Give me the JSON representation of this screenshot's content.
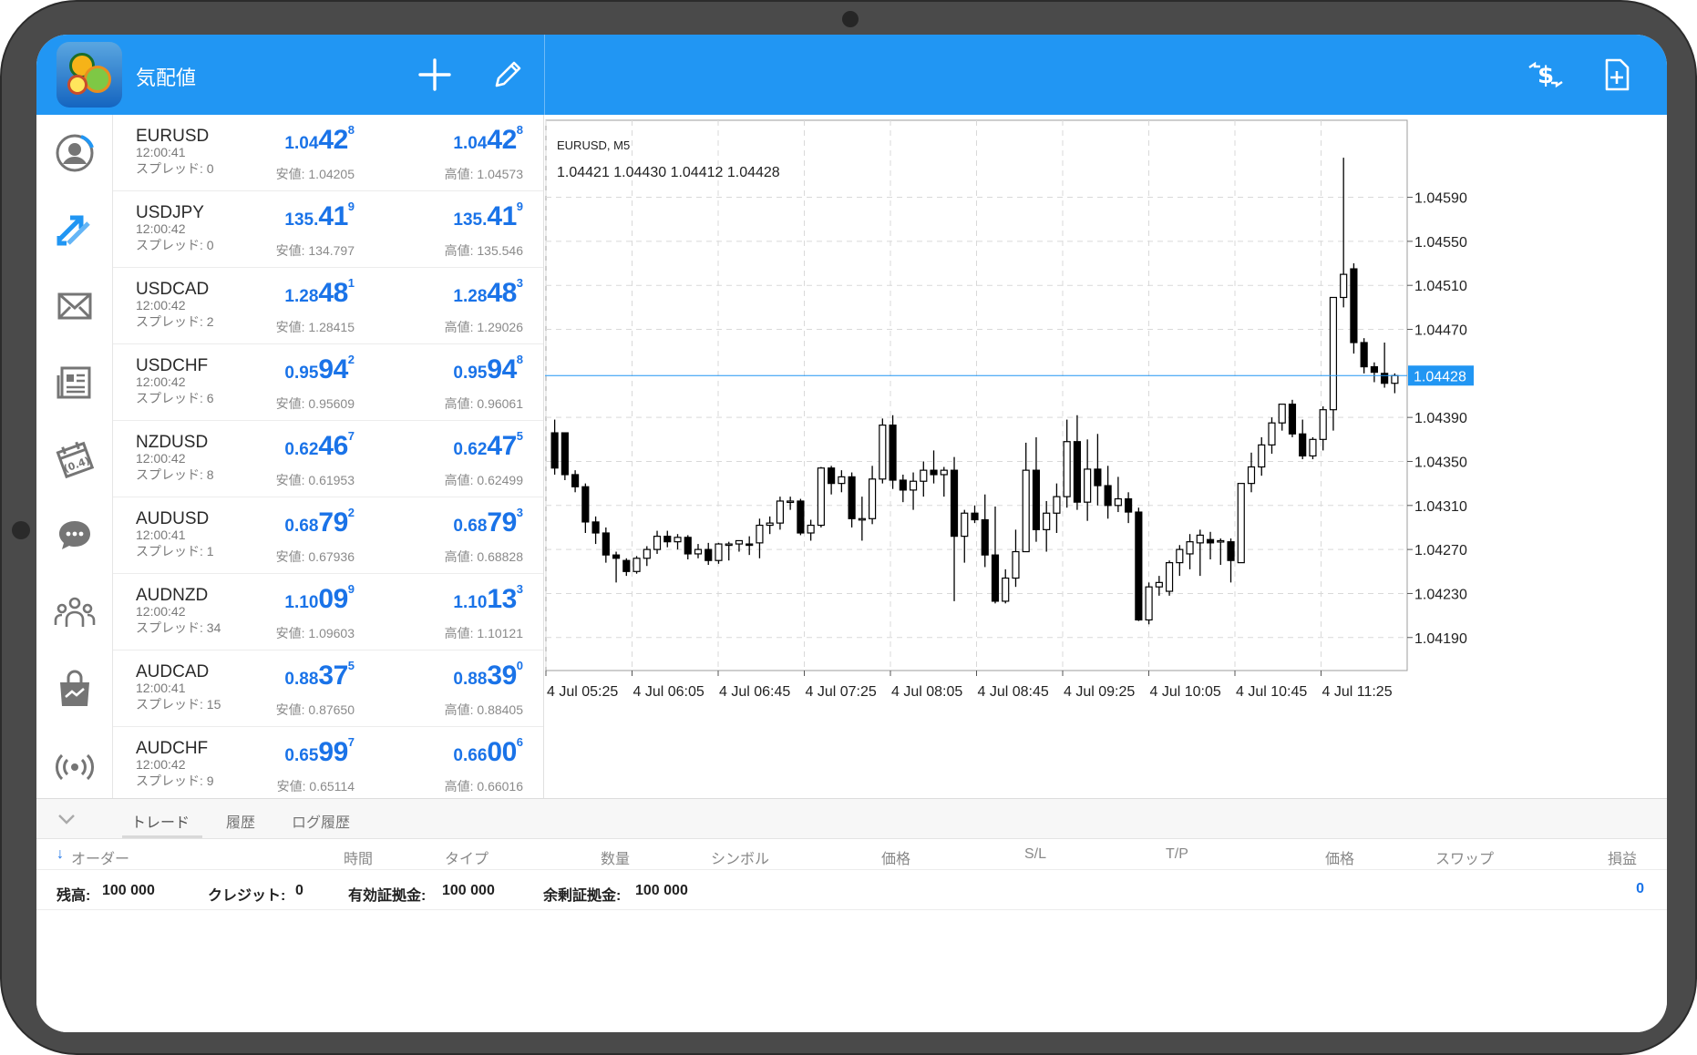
{
  "app": {
    "title": "気配値"
  },
  "nav": [
    {
      "name": "nav-account-icon"
    },
    {
      "name": "nav-trade-icon"
    },
    {
      "name": "nav-mail-icon"
    },
    {
      "name": "nav-news-icon"
    },
    {
      "name": "nav-calendar-icon"
    },
    {
      "name": "nav-chat-icon"
    },
    {
      "name": "nav-community-icon"
    },
    {
      "name": "nav-market-icon"
    },
    {
      "name": "nav-signals-icon"
    }
  ],
  "quotes": [
    {
      "symbol": "EURUSD",
      "time": "12:00:41",
      "spread": "スプレッド: 0",
      "bid": {
        "small": "1.04",
        "big": "42",
        "pip": "8"
      },
      "ask": {
        "small": "1.04",
        "big": "42",
        "pip": "8"
      },
      "low": "安値: 1.04205",
      "high": "高値: 1.04573"
    },
    {
      "symbol": "USDJPY",
      "time": "12:00:42",
      "spread": "スプレッド: 0",
      "bid": {
        "small": "135.",
        "big": "41",
        "pip": "9"
      },
      "ask": {
        "small": "135.",
        "big": "41",
        "pip": "9"
      },
      "low": "安値: 134.797",
      "high": "高値: 135.546"
    },
    {
      "symbol": "USDCAD",
      "time": "12:00:42",
      "spread": "スプレッド: 2",
      "bid": {
        "small": "1.28",
        "big": "48",
        "pip": "1"
      },
      "ask": {
        "small": "1.28",
        "big": "48",
        "pip": "3"
      },
      "low": "安値: 1.28415",
      "high": "高値: 1.29026"
    },
    {
      "symbol": "USDCHF",
      "time": "12:00:42",
      "spread": "スプレッド: 6",
      "bid": {
        "small": "0.95",
        "big": "94",
        "pip": "2"
      },
      "ask": {
        "small": "0.95",
        "big": "94",
        "pip": "8"
      },
      "low": "安値: 0.95609",
      "high": "高値: 0.96061"
    },
    {
      "symbol": "NZDUSD",
      "time": "12:00:42",
      "spread": "スプレッド: 8",
      "bid": {
        "small": "0.62",
        "big": "46",
        "pip": "7"
      },
      "ask": {
        "small": "0.62",
        "big": "47",
        "pip": "5"
      },
      "low": "安値: 0.61953",
      "high": "高値: 0.62499"
    },
    {
      "symbol": "AUDUSD",
      "time": "12:00:41",
      "spread": "スプレッド: 1",
      "bid": {
        "small": "0.68",
        "big": "79",
        "pip": "2"
      },
      "ask": {
        "small": "0.68",
        "big": "79",
        "pip": "3"
      },
      "low": "安値: 0.67936",
      "high": "高値: 0.68828"
    },
    {
      "symbol": "AUDNZD",
      "time": "12:00:42",
      "spread": "スプレッド: 34",
      "bid": {
        "small": "1.10",
        "big": "09",
        "pip": "9"
      },
      "ask": {
        "small": "1.10",
        "big": "13",
        "pip": "3"
      },
      "low": "安値: 1.09603",
      "high": "高値: 1.10121"
    },
    {
      "symbol": "AUDCAD",
      "time": "12:00:41",
      "spread": "スプレッド: 15",
      "bid": {
        "small": "0.88",
        "big": "37",
        "pip": "5"
      },
      "ask": {
        "small": "0.88",
        "big": "39",
        "pip": "0"
      },
      "low": "安値: 0.87650",
      "high": "高値: 0.88405"
    },
    {
      "symbol": "AUDCHF",
      "time": "12:00:42",
      "spread": "スプレッド: 9",
      "bid": {
        "small": "0.65",
        "big": "99",
        "pip": "7"
      },
      "ask": {
        "small": "0.66",
        "big": "00",
        "pip": "6"
      },
      "low": "安値: 0.65114",
      "high": "高値: 0.66016"
    }
  ],
  "chart_data": {
    "type": "candlestick",
    "title": "EURUSD, M5",
    "ohlc_label": "1.04421 1.04430 1.04412 1.04428",
    "current_price": 1.04428,
    "current_price_label": "1.04428",
    "ylim": [
      1.0416,
      1.0466
    ],
    "y_ticks": [
      "1.04590",
      "1.04550",
      "1.04510",
      "1.04470",
      "1.04390",
      "1.04350",
      "1.04310",
      "1.04270",
      "1.04230",
      "1.04190"
    ],
    "x_ticks": [
      "4 Jul 05:25",
      "4 Jul 06:05",
      "4 Jul 06:45",
      "4 Jul 07:25",
      "4 Jul 08:05",
      "4 Jul 08:45",
      "4 Jul 09:25",
      "4 Jul 10:05",
      "4 Jul 10:45",
      "4 Jul 11:25"
    ],
    "candles": [
      [
        1.04376,
        1.04388,
        1.04338,
        1.04344
      ],
      [
        1.04376,
        1.04376,
        1.04333,
        1.04338
      ],
      [
        1.04338,
        1.04342,
        1.04322,
        1.04327
      ],
      [
        1.04327,
        1.0433,
        1.04285,
        1.04295
      ],
      [
        1.04295,
        1.043,
        1.04275,
        1.04285
      ],
      [
        1.04285,
        1.0429,
        1.04258,
        1.04265
      ],
      [
        1.04265,
        1.04268,
        1.0424,
        1.04262
      ],
      [
        1.0426,
        1.04262,
        1.04246,
        1.0425
      ],
      [
        1.0425,
        1.04264,
        1.04248,
        1.04262
      ],
      [
        1.04262,
        1.04273,
        1.04255,
        1.0427
      ],
      [
        1.0427,
        1.04287,
        1.04266,
        1.04282
      ],
      [
        1.04282,
        1.04287,
        1.04272,
        1.04277
      ],
      [
        1.04277,
        1.04284,
        1.0427,
        1.04281
      ],
      [
        1.04281,
        1.04283,
        1.04261,
        1.04266
      ],
      [
        1.04266,
        1.04275,
        1.04262,
        1.0427
      ],
      [
        1.0427,
        1.04276,
        1.04256,
        1.0426
      ],
      [
        1.0426,
        1.04276,
        1.04257,
        1.04275
      ],
      [
        1.04275,
        1.04277,
        1.0426,
        1.04275
      ],
      [
        1.04275,
        1.04278,
        1.04268,
        1.04278
      ],
      [
        1.04275,
        1.04282,
        1.04265,
        1.04274
      ],
      [
        1.04276,
        1.04298,
        1.04262,
        1.04292
      ],
      [
        1.04292,
        1.043,
        1.04284,
        1.04294
      ],
      [
        1.04294,
        1.04318,
        1.04288,
        1.04314
      ],
      [
        1.04314,
        1.04318,
        1.04306,
        1.04314
      ],
      [
        1.04314,
        1.04316,
        1.04283,
        1.04285
      ],
      [
        1.04285,
        1.04297,
        1.04278,
        1.04292
      ],
      [
        1.04292,
        1.04345,
        1.0429,
        1.04344
      ],
      [
        1.04344,
        1.04346,
        1.0432,
        1.0433
      ],
      [
        1.0433,
        1.04342,
        1.04322,
        1.04336
      ],
      [
        1.04336,
        1.0434,
        1.0429,
        1.04298
      ],
      [
        1.04298,
        1.04318,
        1.04278,
        1.04298
      ],
      [
        1.04298,
        1.04346,
        1.04293,
        1.04334
      ],
      [
        1.04334,
        1.04389,
        1.0433,
        1.04383
      ],
      [
        1.04383,
        1.04392,
        1.04325,
        1.04333
      ],
      [
        1.04333,
        1.04338,
        1.04313,
        1.04324
      ],
      [
        1.04324,
        1.0434,
        1.04306,
        1.04332
      ],
      [
        1.04332,
        1.0435,
        1.04318,
        1.04342
      ],
      [
        1.04342,
        1.0436,
        1.0433,
        1.04338
      ],
      [
        1.04338,
        1.04345,
        1.04318,
        1.04342
      ],
      [
        1.04342,
        1.04354,
        1.04223,
        1.04282
      ],
      [
        1.04282,
        1.04306,
        1.04258,
        1.04303
      ],
      [
        1.04303,
        1.0431,
        1.04294,
        1.04297
      ],
      [
        1.04297,
        1.0432,
        1.04254,
        1.04265
      ],
      [
        1.04265,
        1.04309,
        1.04221,
        1.04223
      ],
      [
        1.04223,
        1.04252,
        1.04221,
        1.04244
      ],
      [
        1.04244,
        1.04288,
        1.04236,
        1.04268
      ],
      [
        1.04268,
        1.04367,
        1.04268,
        1.04342
      ],
      [
        1.04342,
        1.04372,
        1.04277,
        1.04288
      ],
      [
        1.04288,
        1.04314,
        1.04268,
        1.04303
      ],
      [
        1.04303,
        1.0433,
        1.04285,
        1.04318
      ],
      [
        1.04318,
        1.04388,
        1.04308,
        1.04368
      ],
      [
        1.04368,
        1.04392,
        1.04306,
        1.04313
      ],
      [
        1.04313,
        1.0437,
        1.04296,
        1.04343
      ],
      [
        1.04343,
        1.04375,
        1.0431,
        1.04328
      ],
      [
        1.04328,
        1.04346,
        1.04298,
        1.0431
      ],
      [
        1.0431,
        1.04336,
        1.04304,
        1.04316
      ],
      [
        1.04316,
        1.04322,
        1.04294,
        1.04304
      ],
      [
        1.04304,
        1.04308,
        1.04205,
        1.04206
      ],
      [
        1.04206,
        1.0424,
        1.04202,
        1.04236
      ],
      [
        1.04236,
        1.04246,
        1.04228,
        1.0424
      ],
      [
        1.04232,
        1.0426,
        1.04228,
        1.04258
      ],
      [
        1.04258,
        1.04274,
        1.04246,
        1.0427
      ],
      [
        1.04266,
        1.04284,
        1.04252,
        1.04277
      ],
      [
        1.04276,
        1.04288,
        1.04246,
        1.04283
      ],
      [
        1.04279,
        1.04286,
        1.04261,
        1.04276
      ],
      [
        1.04278,
        1.0428,
        1.04256,
        1.04278
      ],
      [
        1.04277,
        1.0428,
        1.0424,
        1.0426
      ],
      [
        1.04258,
        1.0433,
        1.04258,
        1.0433
      ],
      [
        1.0433,
        1.04358,
        1.04322,
        1.04345
      ],
      [
        1.04345,
        1.04372,
        1.04337,
        1.04365
      ],
      [
        1.04365,
        1.0439,
        1.04357,
        1.04385
      ],
      [
        1.04385,
        1.04402,
        1.04378,
        1.04402
      ],
      [
        1.04402,
        1.04406,
        1.04372,
        1.04375
      ],
      [
        1.04375,
        1.04388,
        1.04352,
        1.04355
      ],
      [
        1.04355,
        1.04372,
        1.04352,
        1.0437
      ],
      [
        1.0437,
        1.044,
        1.0436,
        1.04397
      ],
      [
        1.04397,
        1.04499,
        1.04378,
        1.04499
      ],
      [
        1.04499,
        1.04626,
        1.0449,
        1.0452
      ],
      [
        1.04525,
        1.0453,
        1.04448,
        1.04458
      ],
      [
        1.04458,
        1.04462,
        1.0443,
        1.04436
      ],
      [
        1.04436,
        1.0444,
        1.04422,
        1.04431
      ],
      [
        1.0443,
        1.04458,
        1.04417,
        1.04421
      ],
      [
        1.04421,
        1.0443,
        1.04412,
        1.04428
      ]
    ],
    "colors": {
      "grid": "#d9d9d9",
      "price_line": "#2196f3",
      "candle": "#000000"
    }
  },
  "bottom": {
    "tabs": [
      "トレード",
      "履歴",
      "ログ履歴"
    ],
    "columns": [
      "オーダー",
      "時間",
      "タイプ",
      "数量",
      "シンボル",
      "価格",
      "S/L",
      "T/P",
      "価格",
      "スワップ",
      "損益"
    ],
    "balance": {
      "label": "残高:",
      "value": "100 000"
    },
    "credit": {
      "label": "クレジット:",
      "value": "0"
    },
    "equity": {
      "label": "有効証拠金:",
      "value": "100 000"
    },
    "free_margin": {
      "label": "余剰証拠金:",
      "value": "100 000"
    },
    "profit": "0"
  },
  "colors": {
    "accent": "#2196f3",
    "price_blue": "#1a73e8"
  }
}
